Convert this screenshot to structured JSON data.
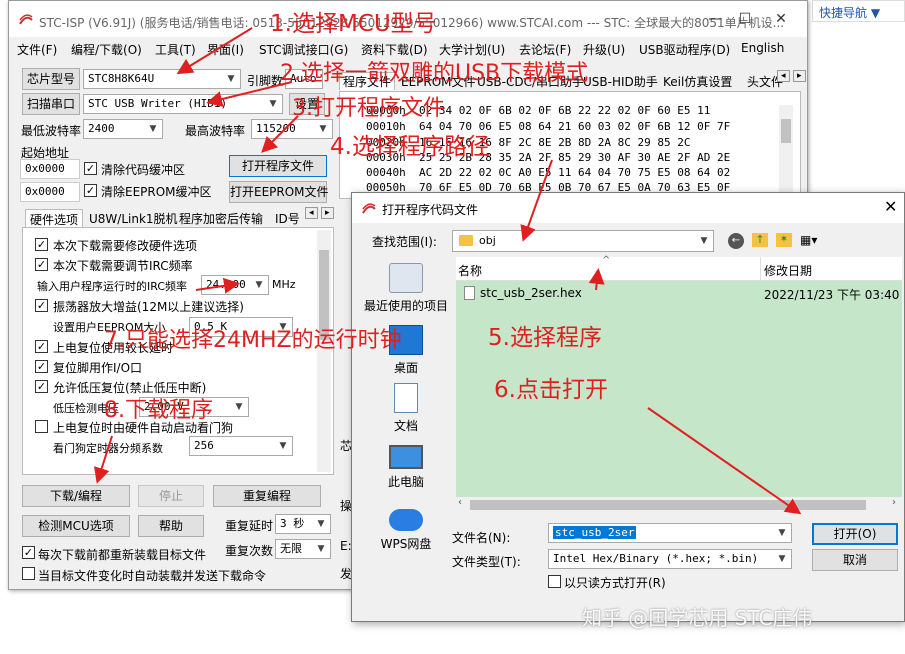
{
  "app": {
    "title": "STC-ISP (V6.91J) (服务电话/销售电话: 0513-55012928/55012929/55012966) www.STCAI.com --- STC: 全球最大的8051单片机设...",
    "window_controls": [
      "—",
      "☐",
      "✕"
    ]
  },
  "menu": [
    "文件(F)",
    "编程/下载(O)",
    "工具(T)",
    "界面(I)",
    "STC调试接口(G)",
    "资料下载(D)",
    "大学计划(U)",
    "去论坛(F)",
    "升级(U)",
    "USB驱动程序(D)",
    "English"
  ],
  "left_panel": {
    "chip_btn": "芯片型号",
    "chip_value": "STC8H8K64U",
    "pin_label": "引脚数",
    "pin_value": "Auto",
    "scan_btn": "扫描串口",
    "port_value": "STC USB Writer (HID1)",
    "settings_btn": "设置",
    "min_baud_label": "最低波特率",
    "min_baud": "2400",
    "max_baud_label": "最高波特率",
    "max_baud": "115200",
    "start_addr_label": "起始地址",
    "addr1": "0x0000",
    "clear_code": "清除代码缓冲区",
    "open_prog_btn": "打开程序文件",
    "addr2": "0x0000",
    "clear_eeprom": "清除EEPROM缓冲区",
    "open_eeprom_btn": "打开EEPROM文件",
    "tabs": [
      "硬件选项",
      "U8W/Link1脱机",
      "程序加密后传输",
      "ID号"
    ],
    "options": [
      "本次下载需要修改硬件选项",
      "本次下载需要调节IRC频率",
      "输入用户程序运行时的IRC频率",
      "振荡器放大增益(12M以上建议选择)",
      "设置用户EEPROM大小",
      "上电复位使用较长延时",
      "复位脚用作I/O口",
      "允许低压复位(禁止低压中断)",
      "低压检测电压",
      "上电复位时由硬件自动启动看门狗",
      "看门狗定时器分频系数"
    ],
    "irc_value": "24.000",
    "irc_unit": "MHz",
    "eeprom_value": "0.5 K",
    "lvd_value": "2.00 V",
    "wdt_value": "256",
    "download_btn": "下载/编程",
    "stop_btn": "停止",
    "reprogram_btn": "重复编程",
    "detect_btn": "检测MCU选项",
    "help_btn": "帮助",
    "repeat_delay_label": "重复延时",
    "repeat_delay": "3 秒",
    "repeat_count_label": "重复次数",
    "repeat_count": "无限",
    "reload_each": "每次下载前都重新装载目标文件",
    "auto_send": "当目标文件变化时自动装载并发送下载命令"
  },
  "right_panel": {
    "tabs": [
      "程序文件",
      "EEPROM文件",
      "USB-CDC/串口助手",
      "USB-HID助手",
      "Keil仿真设置",
      "头文件"
    ],
    "hex_rows": [
      [
        "00000h",
        "02 34 02 0F 6B 02 0F 6B 22 22 02 0F 60 E5 11"
      ],
      [
        "00010h",
        "64 04 70 06 E5 08 64 21 60 03 02 0F 6B 12 0F 7F"
      ],
      [
        "00020h",
        "16 16 16 16 8F 2C 8E 2B 8D 2A 8C 29 85 2C"
      ],
      [
        "00030h",
        "25 25 2B 28 35 2A 2F 85 29 30 AF 30 AE 2F AD 2E"
      ],
      [
        "00040h",
        "AC 2D 22 02 0C A0 E5 11 64 04 70 75 E5 08 64 02"
      ],
      [
        "00050h",
        "70 6F E5 0D 70 6B E5 0B 70 67 E5 0A 70 63 E5 0F"
      ]
    ],
    "side_labels": [
      "芯",
      "操",
      "E:",
      "发"
    ]
  },
  "dialog": {
    "title": "打开程序代码文件",
    "lookin_label": "查找范围(I):",
    "lookin_value": "obj",
    "nav": [
      "最近使用的项目",
      "桌面",
      "文档",
      "此电脑",
      "WPS网盘"
    ],
    "col_name": "名称",
    "col_date": "修改日期",
    "files": [
      {
        "name": "stc_usb_2ser.hex",
        "date": "2022/11/23 下午 03:40"
      }
    ],
    "filename_label": "文件名(N):",
    "filename_value": "stc_usb_2ser",
    "filetype_label": "文件类型(T):",
    "filetype_value": "Intel Hex/Binary (*.hex; *.bin)",
    "readonly_label": "以只读方式打开(R)",
    "open_btn": "打开(O)",
    "cancel_btn": "取消"
  },
  "background": {
    "top_right_text": "快捷导航 ▼"
  },
  "annotations": [
    "1.选择MCU型号",
    "2.选择一箭双雕的USB下载模式",
    "3.打开程序文件",
    "4.选择程序路径",
    "5.选择程序",
    "6.点击打开",
    "7.只能选择24MHZ的运行时钟",
    "8.下载程序"
  ],
  "watermark": "知乎 @国学芯用 STC庄伟",
  "colors": {
    "annotation": "#e02020",
    "list_bg": "#c6e6c9",
    "selection": "#0078d7"
  }
}
